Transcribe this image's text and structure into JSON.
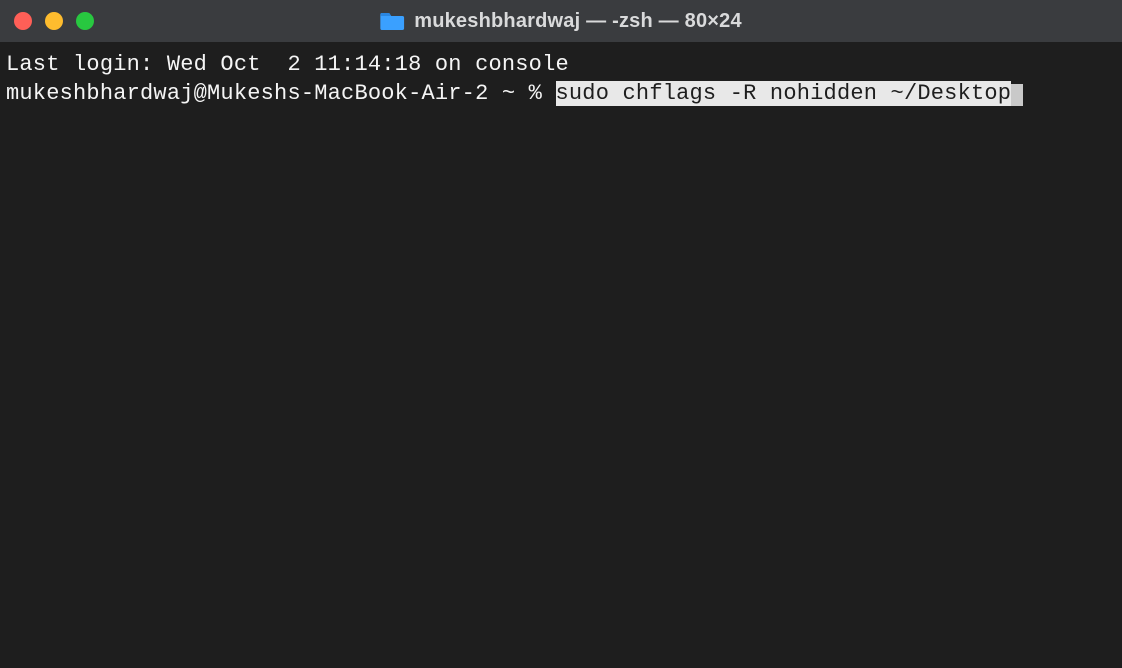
{
  "titlebar": {
    "title": "mukeshbhardwaj — -zsh — 80×24"
  },
  "terminal": {
    "last_login": "Last login: Wed Oct  2 11:14:18 on console",
    "prompt": "mukeshbhardwaj@Mukeshs-MacBook-Air-2 ~ % ",
    "command_highlighted": "sudo chflags -R nohidden ~/Desktop"
  }
}
